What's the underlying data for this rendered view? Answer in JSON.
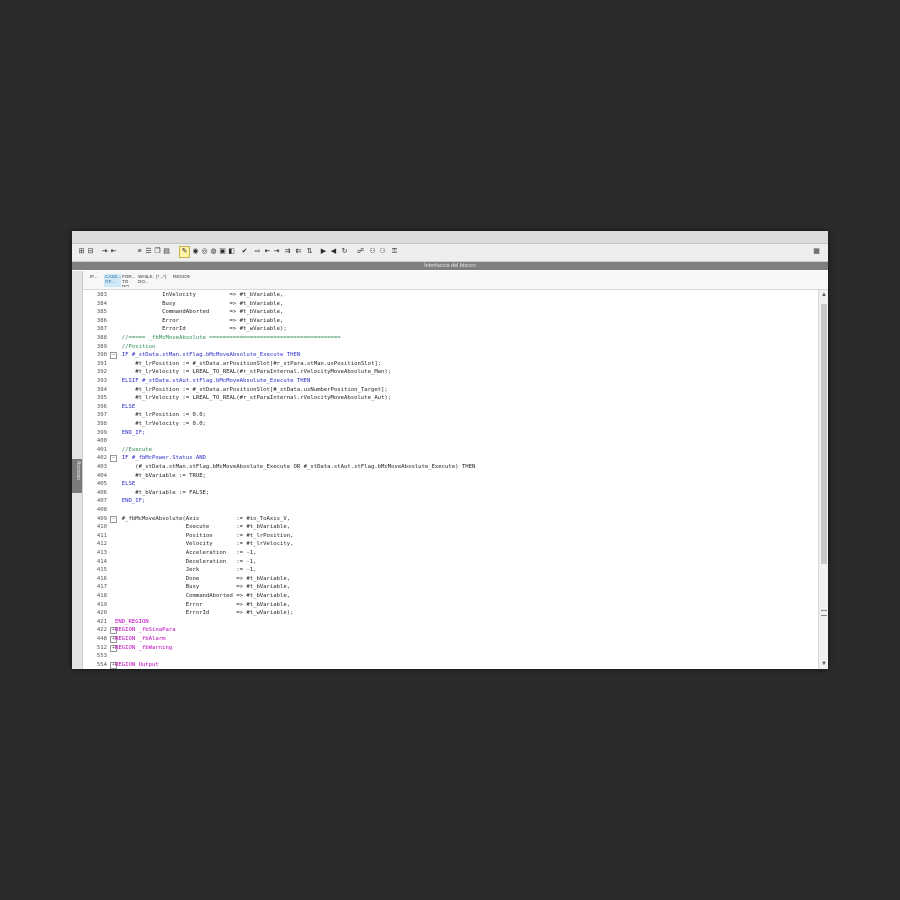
{
  "toolbar": {
    "buttons": [
      {
        "name": "insert-network-icon",
        "glyph": "⊞"
      },
      {
        "name": "delete-network-icon",
        "glyph": "⊟"
      },
      {
        "name": "insert-row-icon",
        "glyph": "⇥"
      },
      {
        "name": "add-row-icon",
        "glyph": "⇤"
      },
      {
        "name": "list-icon",
        "glyph": "≡"
      },
      {
        "name": "list-alt-icon",
        "glyph": "☰"
      },
      {
        "name": "copy-icon",
        "glyph": "❐"
      },
      {
        "name": "paste-icon",
        "glyph": "▤"
      },
      {
        "name": "bookmark-icon",
        "glyph": "✎"
      },
      {
        "name": "monitor-icon",
        "glyph": "◉"
      },
      {
        "name": "monitor-off-icon",
        "glyph": "◎"
      },
      {
        "name": "watch-icon",
        "glyph": "◍"
      },
      {
        "name": "snapshot-icon",
        "glyph": "▣"
      },
      {
        "name": "compare-icon",
        "glyph": "◧"
      },
      {
        "name": "check-icon",
        "glyph": "✔"
      },
      {
        "name": "goto-icon",
        "glyph": "⇨"
      },
      {
        "name": "align-left-icon",
        "glyph": "⇤"
      },
      {
        "name": "align-right-icon",
        "glyph": "⇥"
      },
      {
        "name": "indent-icon",
        "glyph": "⇉"
      },
      {
        "name": "outdent-icon",
        "glyph": "⇇"
      },
      {
        "name": "sort-icon",
        "glyph": "⇅"
      },
      {
        "name": "bookmark-next-icon",
        "glyph": "▶"
      },
      {
        "name": "bookmark-prev-icon",
        "glyph": "◀"
      },
      {
        "name": "refresh-icon",
        "glyph": "↻"
      },
      {
        "name": "network-icon",
        "glyph": "☍"
      },
      {
        "name": "online-icon",
        "glyph": "⚇"
      },
      {
        "name": "offline-icon",
        "glyph": "⚆"
      },
      {
        "name": "lock-icon",
        "glyph": "⚿"
      },
      {
        "name": "window-icon",
        "glyph": "▦"
      }
    ]
  },
  "interface_bar": {
    "label": "Interfaccia del blocco"
  },
  "left_pane": {
    "label": "Accesso"
  },
  "snippets": [
    {
      "label": "IF..."
    },
    {
      "label": "CASE... OF..."
    },
    {
      "label": "FOR... TO DO..."
    },
    {
      "label": "WHILE... DO..."
    },
    {
      "label": "(*...*)"
    },
    {
      "label": "REGION"
    }
  ],
  "code_lines": [
    {
      "n": "383",
      "t": "              InVelocity          => #t_bVariable,",
      "c": "",
      "f": ""
    },
    {
      "n": "384",
      "t": "              Busy                => #t_bVariable,",
      "c": "",
      "f": ""
    },
    {
      "n": "385",
      "t": "              CommandAborted      => #t_bVariable,",
      "c": "",
      "f": ""
    },
    {
      "n": "386",
      "t": "              Error               => #t_bVariable,",
      "c": "",
      "f": ""
    },
    {
      "n": "387",
      "t": "              ErrorId             => #t_wVariable);",
      "c": "",
      "f": ""
    },
    {
      "n": "388",
      "t": "  //===== _fbMcMoveAbsolute =======================================",
      "c": "cm",
      "f": ""
    },
    {
      "n": "389",
      "t": "  //Position",
      "c": "cm",
      "f": ""
    },
    {
      "n": "390",
      "t": "  IF #_stData.stMan.stFlag.bMcMoveAbsolute_Execute THEN",
      "c": "kw",
      "f": "−"
    },
    {
      "n": "391",
      "t": "      #t_lrPosition := #_stData.arPositionSlot[#r_stPara.stMan.usPositionSlot];",
      "c": "",
      "f": ""
    },
    {
      "n": "392",
      "t": "      #t_lrVelocity := LREAL_TO_REAL(#r_stParaInternal.rVelocityMoveAbsolute_Man);",
      "c": "",
      "f": ""
    },
    {
      "n": "393",
      "t": "  ELSIF #_stData.stAut.stFlag.bMcMoveAbsolute_Execute THEN",
      "c": "kw",
      "f": ""
    },
    {
      "n": "394",
      "t": "      #t_lrPosition := #_stData.arPositionSlot[#_stData.usNumberPosition_Target];",
      "c": "",
      "f": ""
    },
    {
      "n": "395",
      "t": "      #t_lrVelocity := LREAL_TO_REAL(#r_stParaInternal.rVelocityMoveAbsolute_Aut);",
      "c": "",
      "f": ""
    },
    {
      "n": "396",
      "t": "  ELSE",
      "c": "kw",
      "f": ""
    },
    {
      "n": "397",
      "t": "      #t_lrPosition := 0.0;",
      "c": "",
      "f": ""
    },
    {
      "n": "398",
      "t": "      #t_lrVelocity := 0.0;",
      "c": "",
      "f": ""
    },
    {
      "n": "399",
      "t": "  END_IF;",
      "c": "kw",
      "f": ""
    },
    {
      "n": "400",
      "t": "",
      "c": "",
      "f": ""
    },
    {
      "n": "401",
      "t": "  //Execute",
      "c": "cm",
      "f": ""
    },
    {
      "n": "402",
      "t": "  IF #_fbMcPower.Status AND",
      "c": "kw",
      "f": "−"
    },
    {
      "n": "403",
      "t": "      (#_stData.stMan.stFlag.bMcMoveAbsolute_Execute OR #_stData.stAut.stFlag.bMcMoveAbsolute_Execute) THEN",
      "c": "",
      "f": ""
    },
    {
      "n": "404",
      "t": "      #t_bVariable := TRUE;",
      "c": "",
      "f": ""
    },
    {
      "n": "405",
      "t": "  ELSE",
      "c": "kw",
      "f": ""
    },
    {
      "n": "406",
      "t": "      #t_bVariable := FALSE;",
      "c": "",
      "f": ""
    },
    {
      "n": "407",
      "t": "  END_IF;",
      "c": "kw",
      "f": ""
    },
    {
      "n": "408",
      "t": "",
      "c": "",
      "f": ""
    },
    {
      "n": "409",
      "t": "  #_fbMcMoveAbsolute(Axis           := #io_ToAxis_V,",
      "c": "",
      "f": "−"
    },
    {
      "n": "410",
      "t": "                     Execute        := #t_bVariable,",
      "c": "",
      "f": ""
    },
    {
      "n": "411",
      "t": "                     Position       := #t_lrPosition,",
      "c": "",
      "f": ""
    },
    {
      "n": "412",
      "t": "                     Velocity       := #t_lrVelocity,",
      "c": "",
      "f": ""
    },
    {
      "n": "413",
      "t": "                     Acceleration   := -1,",
      "c": "",
      "f": ""
    },
    {
      "n": "414",
      "t": "                     Deceleration   := -1,",
      "c": "",
      "f": ""
    },
    {
      "n": "415",
      "t": "                     Jerk           := -1,",
      "c": "",
      "f": ""
    },
    {
      "n": "416",
      "t": "                     Done           => #t_bVariable,",
      "c": "",
      "f": ""
    },
    {
      "n": "417",
      "t": "                     Busy           => #t_bVariable,",
      "c": "",
      "f": ""
    },
    {
      "n": "418",
      "t": "                     CommandAborted => #t_bVariable,",
      "c": "",
      "f": ""
    },
    {
      "n": "419",
      "t": "                     Error          => #t_bVariable,",
      "c": "",
      "f": ""
    },
    {
      "n": "420",
      "t": "                     ErrorId        => #t_wVariable);",
      "c": "",
      "f": ""
    },
    {
      "n": "421",
      "t": "END_REGION",
      "c": "rg",
      "f": ""
    },
    {
      "n": "422",
      "t": "REGION _fbSinaPara",
      "c": "rg",
      "f": "+"
    },
    {
      "n": "448",
      "t": "REGION _fbAlarm",
      "c": "rg",
      "f": "+"
    },
    {
      "n": "512",
      "t": "REGION _fbWarning",
      "c": "rg",
      "f": "+"
    },
    {
      "n": "553",
      "t": "",
      "c": "",
      "f": ""
    },
    {
      "n": "554",
      "t": "REGION Output",
      "c": "rg",
      "f": "+"
    }
  ]
}
